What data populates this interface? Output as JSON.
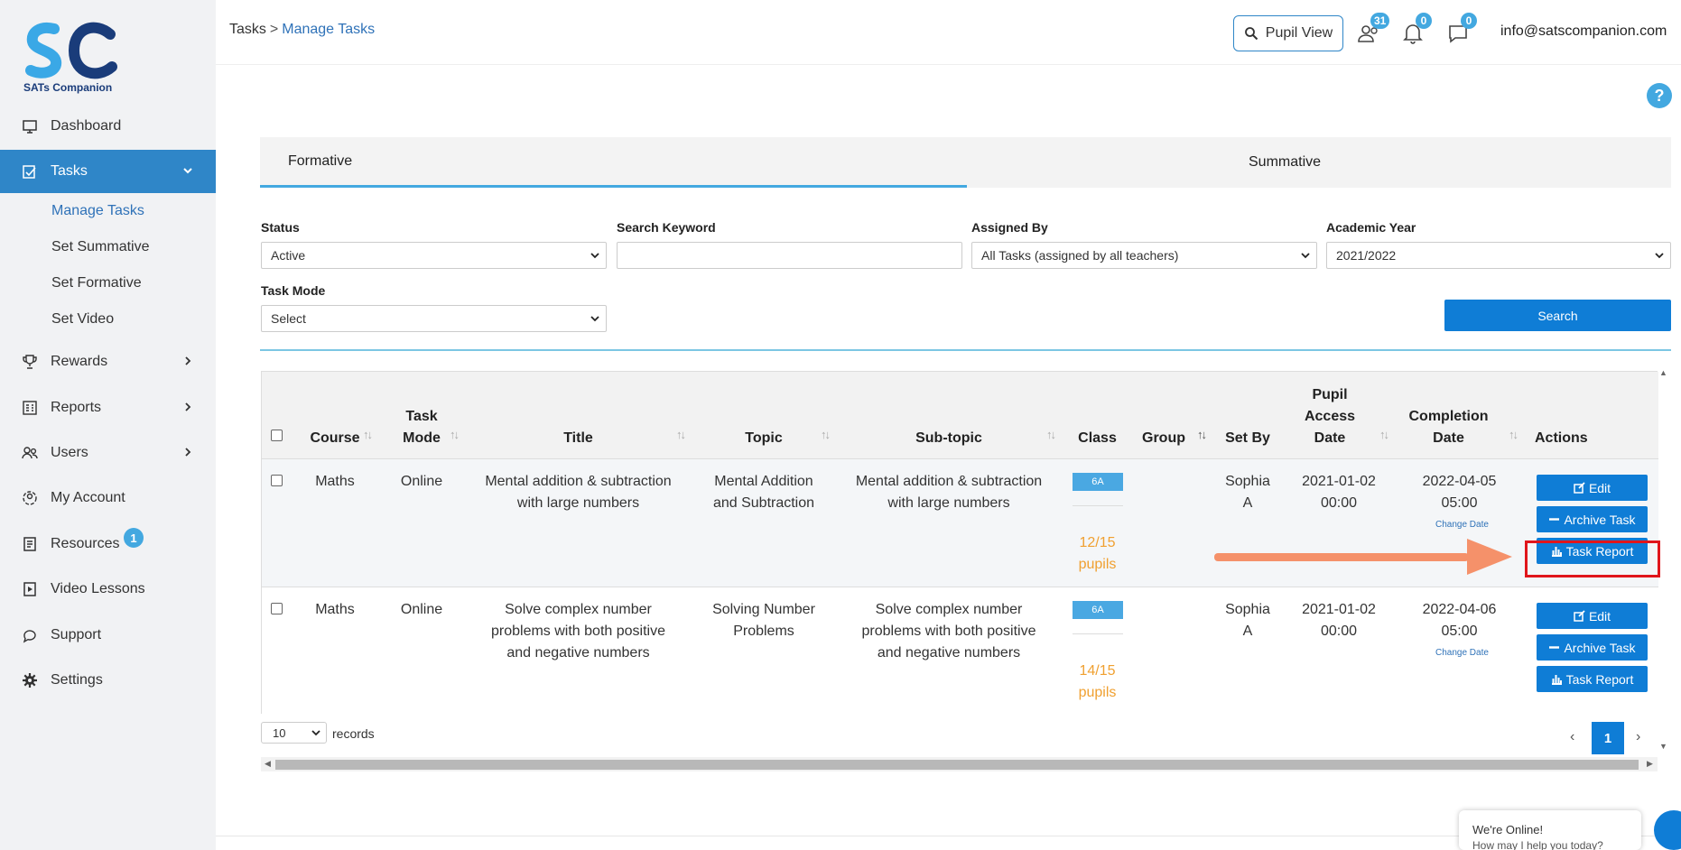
{
  "brand": {
    "logo_text": "SATs Companion",
    "accent": "#2f86c8",
    "button": "#0f7dd6",
    "badge": "#43a8e0"
  },
  "sidebar": {
    "items": [
      {
        "label": "Dashboard",
        "icon": "monitor-icon"
      },
      {
        "label": "Tasks",
        "icon": "tasks-icon",
        "active": true
      },
      {
        "label": "Rewards",
        "icon": "trophy-icon"
      },
      {
        "label": "Reports",
        "icon": "reports-icon"
      },
      {
        "label": "Users",
        "icon": "users-icon"
      },
      {
        "label": "My Account",
        "icon": "account-icon"
      },
      {
        "label": "Resources",
        "icon": "resources-icon",
        "badge": "1"
      },
      {
        "label": "Video Lessons",
        "icon": "video-icon"
      },
      {
        "label": "Support",
        "icon": "support-icon"
      },
      {
        "label": "Settings",
        "icon": "gear-icon"
      }
    ],
    "sub_items": [
      "Manage Tasks",
      "Set Summative",
      "Set Formative",
      "Set Video"
    ]
  },
  "header": {
    "breadcrumb": {
      "parent": "Tasks",
      "current": "Manage Tasks"
    },
    "pupil_view": "Pupil View",
    "users_badge": "31",
    "notif_badge": "0",
    "msg_badge": "0",
    "email": "info@satscompanion.com",
    "help": "?"
  },
  "tabs": [
    "Formative",
    "Summative"
  ],
  "filters": {
    "status": {
      "label": "Status",
      "value": "Active"
    },
    "keyword": {
      "label": "Search Keyword",
      "value": ""
    },
    "assigned_by": {
      "label": "Assigned By",
      "value": "All Tasks (assigned by all teachers)"
    },
    "academic_year": {
      "label": "Academic Year",
      "value": "2021/2022"
    },
    "task_mode": {
      "label": "Task Mode",
      "value": "Select"
    },
    "search_button": "Search"
  },
  "table": {
    "headers": [
      "Course",
      "Task Mode",
      "Title",
      "Topic",
      "Sub-topic",
      "Class",
      "Group",
      "Set By",
      "Pupil Access Date",
      "Completion Date",
      "Actions"
    ],
    "header_lines": {
      "task_mode": [
        "Task",
        "Mode"
      ],
      "pupil_access": [
        "Pupil",
        "Access",
        "Date"
      ],
      "completion": [
        "Completion",
        "Date"
      ]
    },
    "rows": [
      {
        "course": "Maths",
        "mode": "Online",
        "title": [
          "Mental addition & subtraction",
          "with large numbers"
        ],
        "topic": [
          "Mental Addition",
          "and Subtraction"
        ],
        "subtopic": [
          "Mental addition & subtraction",
          "with large numbers"
        ],
        "class": "6A",
        "pupils": [
          "12/15",
          "pupils"
        ],
        "set_by": [
          "Sophia",
          "A"
        ],
        "access": [
          "2021-01-02",
          "00:00"
        ],
        "completion": [
          "2022-04-05",
          "05:00"
        ],
        "change_date": "Change Date"
      },
      {
        "course": "Maths",
        "mode": "Online",
        "title": [
          "Solve complex number",
          "problems with both positive",
          "and negative numbers"
        ],
        "topic": [
          "Solving Number",
          "Problems"
        ],
        "subtopic": [
          "Solve complex number",
          "problems with both positive",
          "and negative numbers"
        ],
        "class": "6A",
        "pupils": [
          "14/15",
          "pupils"
        ],
        "set_by": [
          "Sophia",
          "A"
        ],
        "access": [
          "2021-01-02",
          "00:00"
        ],
        "completion": [
          "2022-04-06",
          "05:00"
        ],
        "change_date": "Change Date"
      }
    ],
    "actions": {
      "edit": "Edit",
      "archive": "Archive Task",
      "report": "Task Report"
    }
  },
  "pagination": {
    "page_size": "10",
    "records_label": "records",
    "current_page": "1",
    "prev": "‹",
    "next": "›"
  },
  "chat": {
    "line1": "We're Online!",
    "line2": "How may I help you today?"
  }
}
